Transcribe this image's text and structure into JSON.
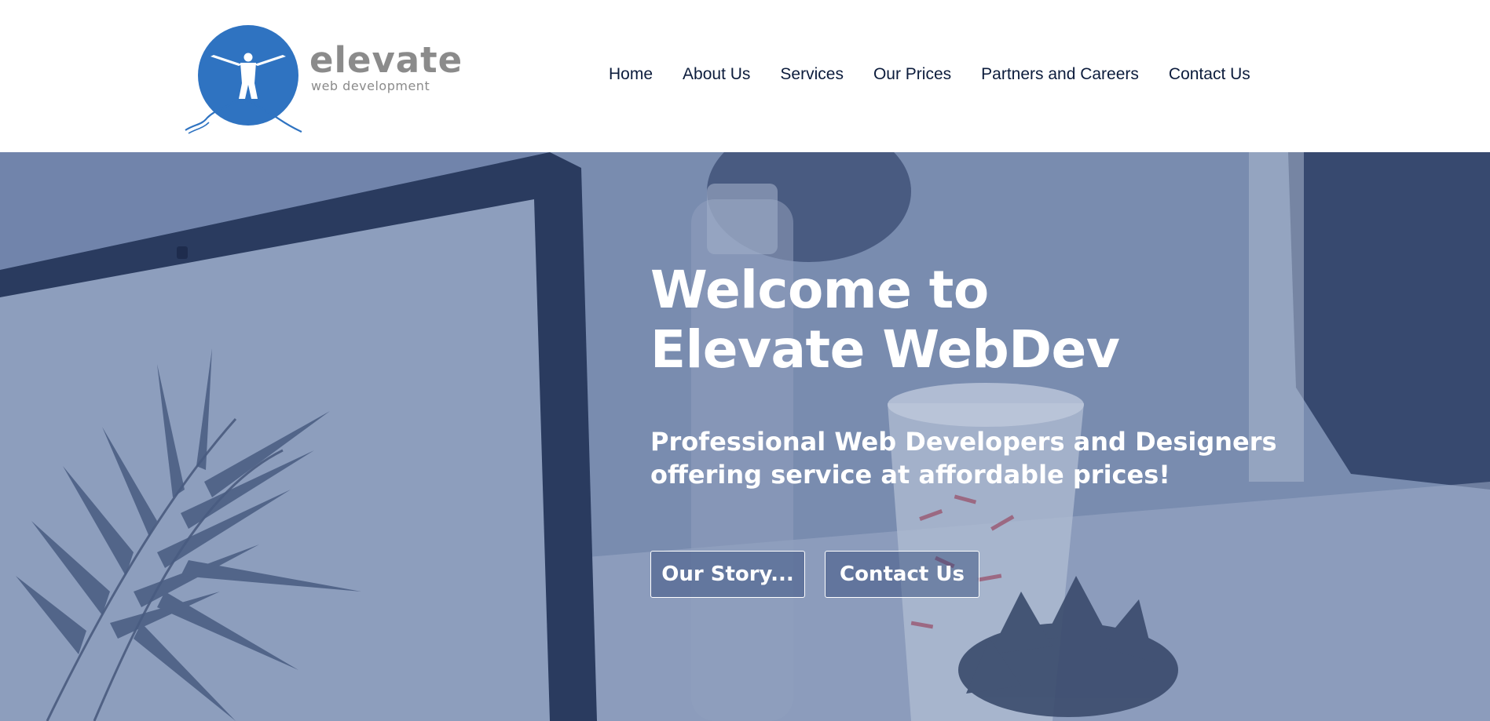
{
  "brand": {
    "name": "elevate",
    "tagline": "web development",
    "logo_color": "#2f73c1",
    "text_color": "#8b8b8b"
  },
  "nav": {
    "items": [
      {
        "label": "Home"
      },
      {
        "label": "About Us"
      },
      {
        "label": "Services"
      },
      {
        "label": "Our Prices"
      },
      {
        "label": "Partners and Careers"
      },
      {
        "label": "Contact Us"
      }
    ],
    "color": "#0c1c3c"
  },
  "hero": {
    "title_line1": "Welcome to",
    "title_line2": "Elevate WebDev",
    "subtitle": "Professional Web Developers and Designers offering service at affordable prices!",
    "buttons": {
      "story": "Our Story...",
      "contact": "Contact Us"
    },
    "overlay_color": "#5f75a0"
  }
}
